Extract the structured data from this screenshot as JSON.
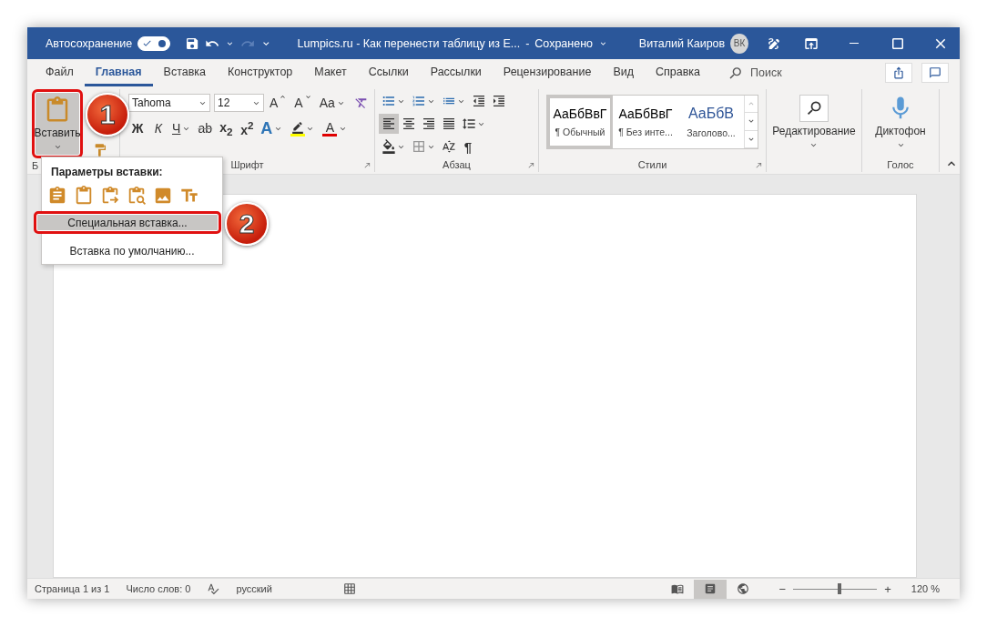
{
  "titlebar": {
    "autosave_label": "Автосохранение",
    "autosave_on": true,
    "document_title": "Lumpics.ru - Как перенести таблицу из E...",
    "title_separator": "-",
    "save_state": "Сохранено",
    "user_name": "Виталий Каиров",
    "user_initials": "ВК"
  },
  "tabs": [
    {
      "label": "Файл",
      "selected": false
    },
    {
      "label": "Главная",
      "selected": true
    },
    {
      "label": "Вставка",
      "selected": false
    },
    {
      "label": "Конструктор",
      "selected": false
    },
    {
      "label": "Макет",
      "selected": false
    },
    {
      "label": "Ссылки",
      "selected": false
    },
    {
      "label": "Рассылки",
      "selected": false
    },
    {
      "label": "Рецензирование",
      "selected": false
    },
    {
      "label": "Вид",
      "selected": false
    },
    {
      "label": "Справка",
      "selected": false
    }
  ],
  "search": {
    "placeholder": "Поиск"
  },
  "clipboard": {
    "paste_label": "Вставить",
    "paste_pressed": true,
    "paste_highlighted": true,
    "group_label": "Б"
  },
  "font": {
    "font_name": "Tahoma",
    "font_size": "12",
    "size_buttons": [
      {
        "kind": "grow",
        "label": "A"
      },
      {
        "kind": "shrink",
        "label": "A"
      }
    ],
    "case_label": "Aa",
    "format_buttons": [
      {
        "kind": "bold",
        "label": "Ж"
      },
      {
        "kind": "italic",
        "label": "К"
      },
      {
        "kind": "underline",
        "label": "Ч"
      },
      {
        "kind": "strike",
        "label": "ab"
      },
      {
        "kind": "subscript",
        "label": "x$_{2}$"
      },
      {
        "kind": "superscript",
        "label": "x$^{2}$"
      }
    ],
    "color_buttons": [
      {
        "kind": "effects",
        "label": "A",
        "color": "#2e75b6"
      },
      {
        "kind": "highlight",
        "color": "#ffff00"
      },
      {
        "kind": "font_color",
        "label": "A",
        "color": "#e00000"
      }
    ],
    "group_label": "Шрифт"
  },
  "paragraph": {
    "alignments": [
      {
        "kind": "left",
        "selected": true
      },
      {
        "kind": "center",
        "selected": false
      },
      {
        "kind": "right",
        "selected": false
      },
      {
        "kind": "justify",
        "selected": false
      }
    ],
    "show_marks": "¶",
    "group_label": "Абзац"
  },
  "styles": {
    "items": [
      {
        "kind": "normal",
        "preview": "АаБбВвГ",
        "name": "¶ Обычный",
        "selected": true
      },
      {
        "kind": "normal",
        "preview": "АаБбВвГ",
        "name": "¶ Без инте...",
        "selected": false
      },
      {
        "kind": "heading",
        "preview": "АаБбВ",
        "name": "Заголово...",
        "selected": false
      }
    ],
    "group_label": "Стили"
  },
  "editing": {
    "label": "Редактирование"
  },
  "voice": {
    "label": "Диктофон",
    "group_label": "Голос"
  },
  "paste_menu": {
    "heading": "Параметры вставки:",
    "items": [
      {
        "label": "Специальная вставка...",
        "selected": true,
        "highlighted": true
      },
      {
        "label": "Вставка по умолчанию...",
        "selected": false,
        "highlighted": false
      }
    ]
  },
  "callouts": [
    {
      "number": "1"
    },
    {
      "number": "2"
    }
  ],
  "status_bar": {
    "page": "Страница 1 из 1",
    "words": "Число слов: 0",
    "language": "русский",
    "views": [
      {
        "kind": "read",
        "selected": false
      },
      {
        "kind": "print",
        "selected": true
      },
      {
        "kind": "web",
        "selected": false
      }
    ],
    "zoom_minus": "−",
    "zoom_plus": "+",
    "zoom": {
      "level": 0.55
    },
    "zoom_label": "120 %"
  }
}
